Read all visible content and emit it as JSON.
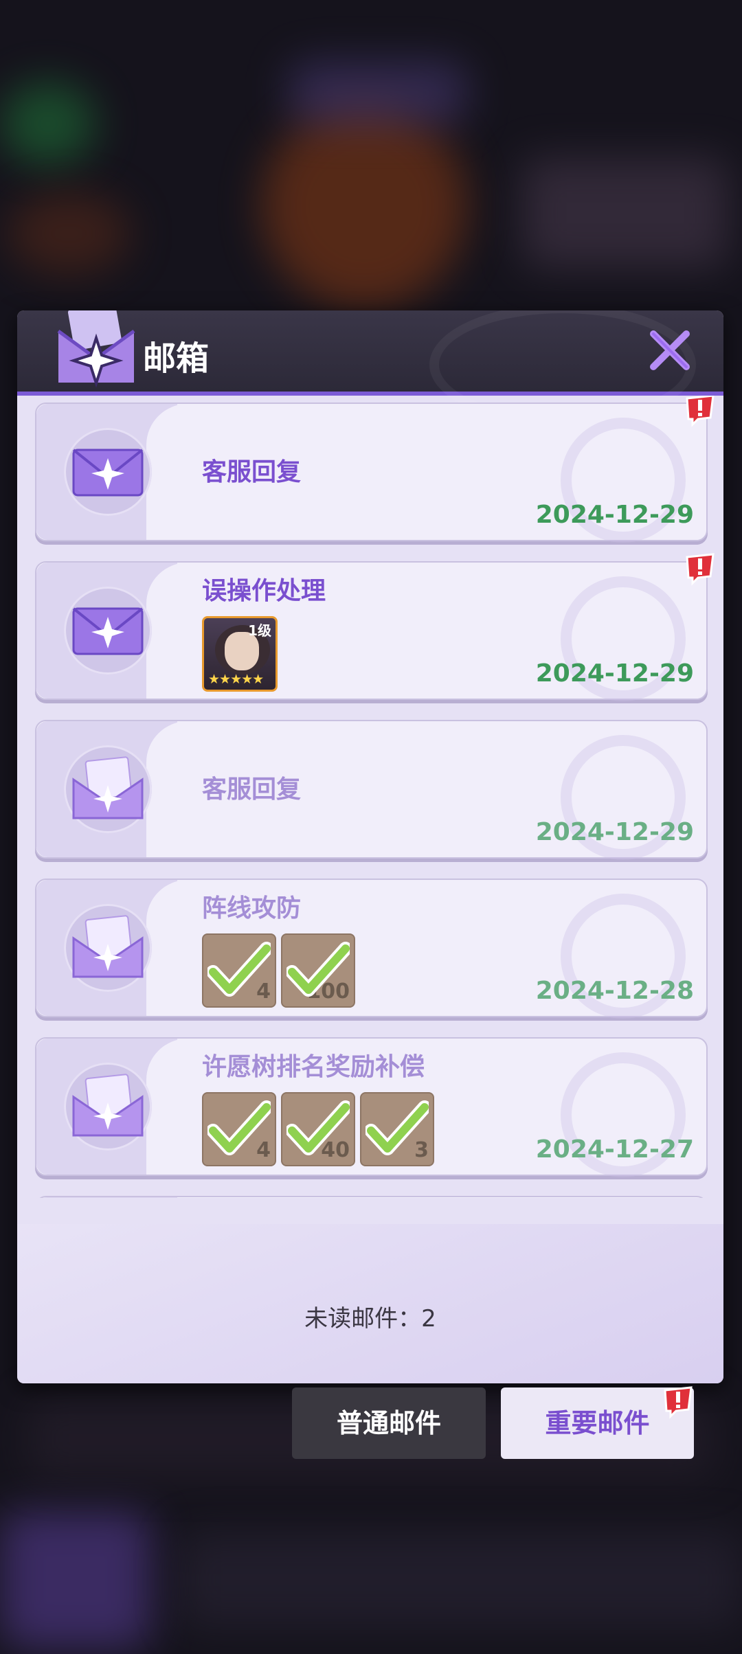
{
  "header": {
    "title": "邮箱"
  },
  "mails": [
    {
      "subject": "客服回复",
      "date": "2024-12-29",
      "read": false,
      "alert": true
    },
    {
      "subject": "误操作处理",
      "date": "2024-12-29",
      "read": false,
      "alert": true,
      "hero_item": {
        "level": "1级",
        "stars": "★★★★★"
      }
    },
    {
      "subject": "客服回复",
      "date": "2024-12-29",
      "read": true,
      "alert": false
    },
    {
      "subject": "阵线攻防",
      "date": "2024-12-28",
      "read": true,
      "alert": false,
      "items": [
        "4",
        "100"
      ]
    },
    {
      "subject": "许愿树排名奖励补偿",
      "date": "2024-12-27",
      "read": true,
      "alert": false,
      "items": [
        "4",
        "40",
        "3"
      ]
    }
  ],
  "footer": {
    "unread_label": "未读邮件：2"
  },
  "tabs": {
    "normal": "普通邮件",
    "important": "重要邮件"
  },
  "colors": {
    "accent": "#7a4fcf",
    "date_green": "#3d9a5a",
    "alert_red": "#e0303a"
  }
}
